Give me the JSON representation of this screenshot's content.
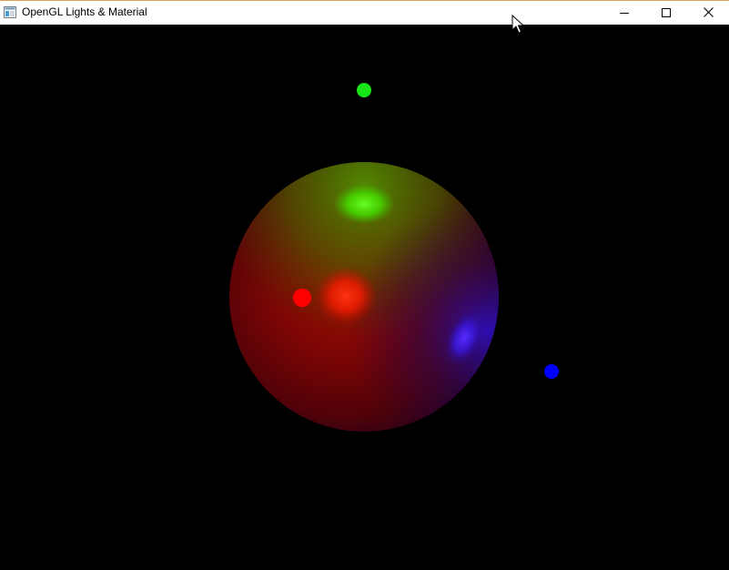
{
  "window": {
    "title": "OpenGL Lights & Material",
    "controls": [
      "minimize",
      "maximize",
      "close"
    ]
  },
  "scene": {
    "background_color": "#000000",
    "sphere": {
      "base_color": "#6b0000",
      "highlights": [
        {
          "color": "#55ff00"
        },
        {
          "color": "#ff2200"
        },
        {
          "color": "#3a1aff"
        }
      ]
    },
    "lights": [
      {
        "name": "green-light",
        "color": "#19e619"
      },
      {
        "name": "red-light",
        "color": "#ff0000"
      },
      {
        "name": "blue-light",
        "color": "#0000ff"
      }
    ]
  },
  "icons": {
    "app": "app-window-icon",
    "minimize": "minimize-icon",
    "maximize": "maximize-icon",
    "close": "close-icon",
    "cursor": "mouse-cursor-icon"
  }
}
